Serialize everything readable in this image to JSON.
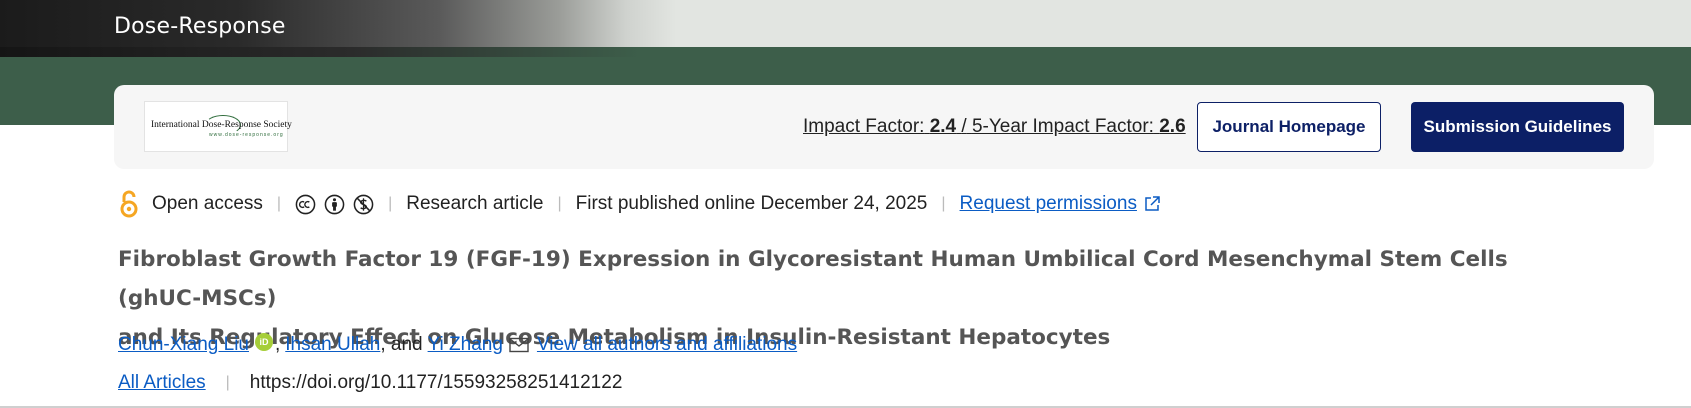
{
  "header": {
    "journal_name": "Dose-Response"
  },
  "journal_card": {
    "logo_text": "International Dose-Response Society",
    "logo_subtext": "www.dose-response.org",
    "impact_factor_label": "Impact Factor:",
    "impact_factor_value": "2.4",
    "impact_divider": "/",
    "five_year_label": "5-Year Impact Factor:",
    "five_year_value": "2.6",
    "homepage_button": "Journal Homepage",
    "guidelines_button": "Submission Guidelines"
  },
  "meta": {
    "access_label": "Open access",
    "article_type": "Research article",
    "published": "First published online December 24, 2025",
    "permissions_link": "Request permissions",
    "separator": "|"
  },
  "article": {
    "title_line1": "Fibroblast Growth Factor 19 (FGF-19) Expression in Glycoresistant Human Umbilical Cord Mesenchymal Stem Cells (ghUC-MSCs)",
    "title_line2": "and Its Regulatory Effect on Glucose Metabolism in Insulin-Resistant Hepatocytes",
    "authors": [
      {
        "name": "Chun-Xiang Liu"
      },
      {
        "name": "Ihsan Ullah"
      },
      {
        "name": "Yi Zhang"
      }
    ],
    "author_sep_comma": ",",
    "author_and": ", and",
    "view_all_link": "View all authors and affiliations",
    "all_articles_link": "All Articles",
    "doi": "https://doi.org/10.1177/15593258251412122"
  },
  "colors": {
    "green_band": "#3d5e4a",
    "primary_navy": "#0c1f66",
    "link_blue": "#0b5cc4",
    "open_access_orange": "#f5a623",
    "orcid_green": "#a6ce39"
  }
}
